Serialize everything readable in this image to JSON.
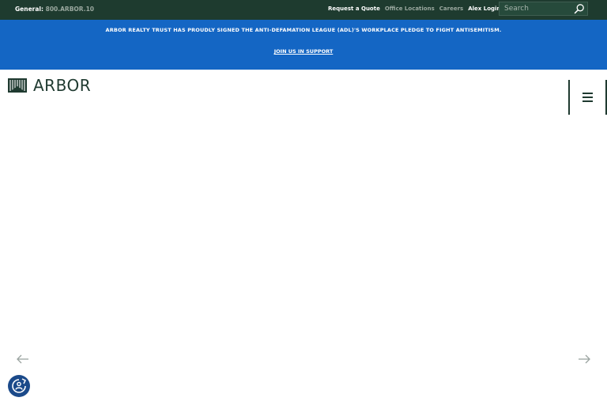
{
  "topbar": {
    "phone_label": "General:",
    "phone_number": "800.ARBOR.10",
    "links": [
      {
        "label": "Request a Quote"
      },
      {
        "label": "Office Locations"
      },
      {
        "label": "Careers"
      },
      {
        "label": "Alex Login"
      }
    ],
    "search": {
      "placeholder": "Search",
      "value": ""
    }
  },
  "banner": {
    "message": "ARBOR REALTY TRUST HAS PROUDLY SIGNED THE ANTI-DEFAMATION LEAGUE (ADL)'S WORKPLACE PLEDGE TO FIGHT ANTISEMITISM.",
    "link_label": "JOIN US IN SUPPORT"
  },
  "header": {
    "logo_text": "ARBOR",
    "menu_icon": "hamburger-icon"
  },
  "hero": {
    "prev_icon": "arrow-left-icon",
    "next_icon": "arrow-right-icon"
  },
  "consent": {
    "icon": "cookie-consent-icon"
  },
  "colors": {
    "topbar_bg": "#1e3b2f",
    "banner_bg": "#1466c4",
    "brand_dark": "#1f3a30",
    "consent_bg": "#1b4a8a"
  }
}
